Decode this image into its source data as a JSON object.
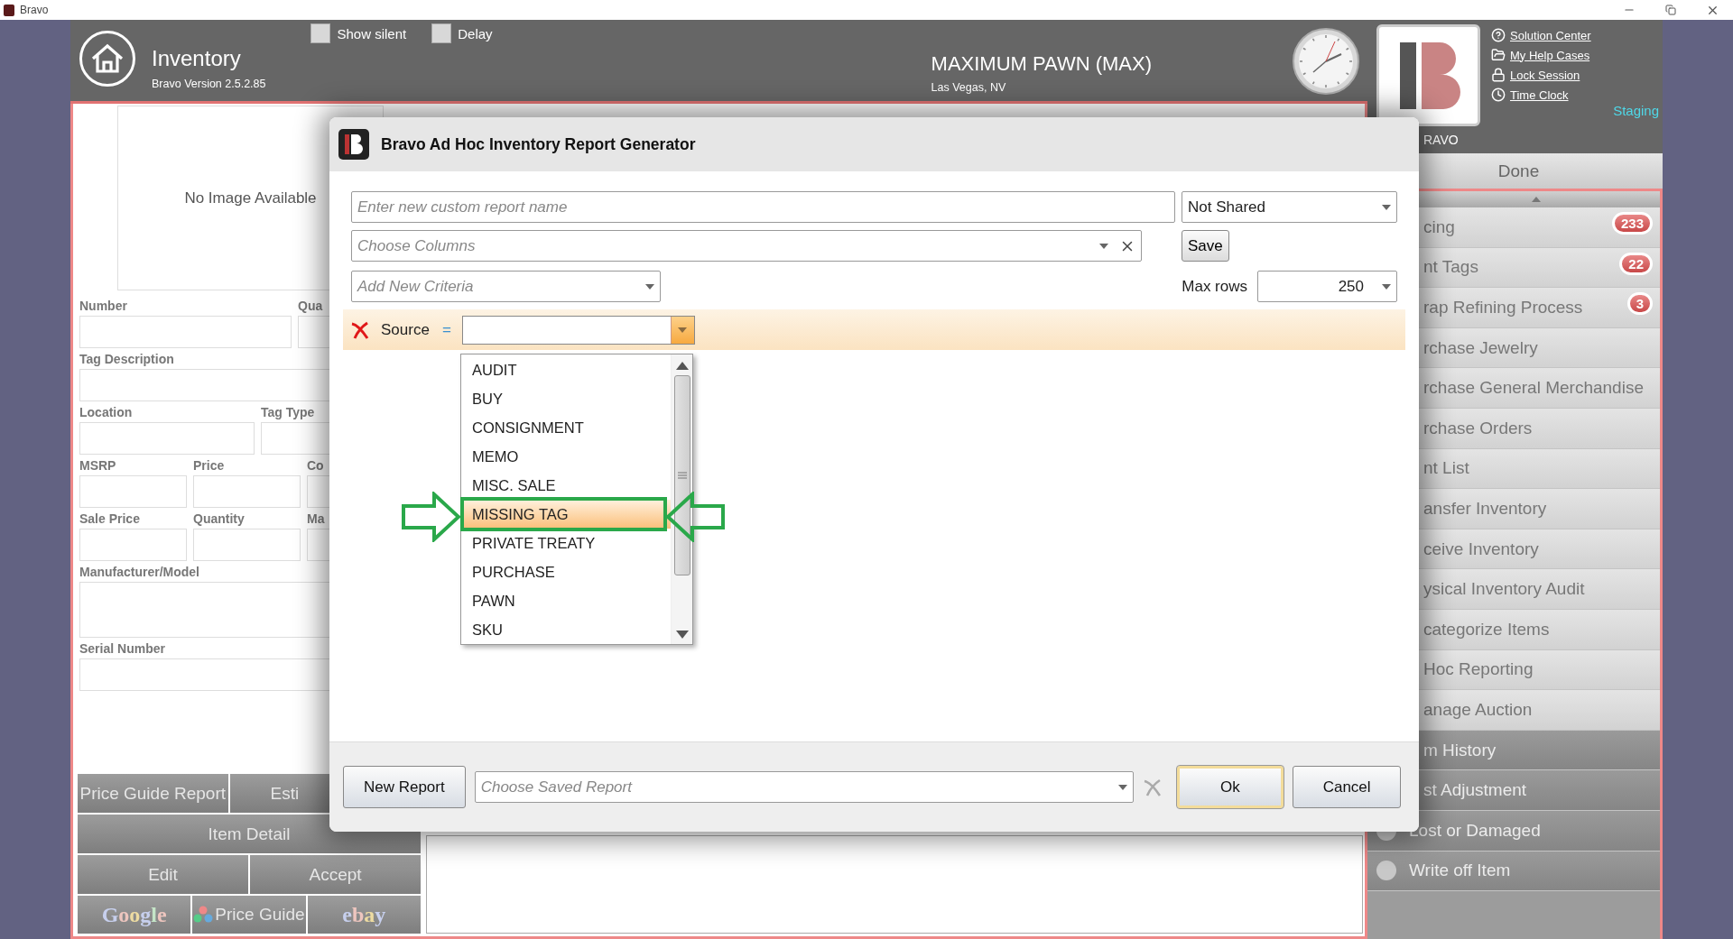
{
  "window": {
    "title": "Bravo"
  },
  "header": {
    "title": "Inventory",
    "version": "Bravo Version 2.5.2.85",
    "options": [
      {
        "label": "Show silent",
        "checked": false
      },
      {
        "label": "Delay",
        "checked": false
      }
    ],
    "store_name": "MAXIMUM PAWN (MAX)",
    "store_location": "Las Vegas, NV"
  },
  "account": {
    "links": [
      {
        "label": "Solution Center",
        "kind": "help"
      },
      {
        "label": "My Help Cases",
        "kind": "cases"
      },
      {
        "label": "Lock Session",
        "kind": "lock"
      },
      {
        "label": "Time Clock",
        "kind": "clock"
      }
    ],
    "environment": "Staging",
    "logo_caption": "RAVO"
  },
  "sidebar": {
    "done_label": "Done",
    "items": [
      {
        "label": "cing",
        "badge": "233",
        "kind": "task",
        "disabled": false
      },
      {
        "label": "nt Tags",
        "badge": "22",
        "kind": "task",
        "disabled": false
      },
      {
        "label": "rap Refining Process",
        "badge": "3",
        "kind": "task",
        "disabled": false
      },
      {
        "label": "rchase Jewelry",
        "kind": "task",
        "disabled": false
      },
      {
        "label": "rchase General Merchandise",
        "kind": "task",
        "disabled": false
      },
      {
        "label": "rchase Orders",
        "kind": "task",
        "disabled": false
      },
      {
        "label": "nt List",
        "kind": "task",
        "disabled": false
      },
      {
        "label": "ansfer Inventory",
        "kind": "task",
        "disabled": false
      },
      {
        "label": "ceive Inventory",
        "kind": "task",
        "disabled": false
      },
      {
        "label": "ysical Inventory Audit",
        "kind": "task",
        "disabled": false
      },
      {
        "label": "categorize Items",
        "kind": "task",
        "disabled": false
      },
      {
        "label": "Hoc Reporting",
        "kind": "task",
        "disabled": false
      },
      {
        "label": "anage Auction",
        "kind": "task",
        "disabled": false
      },
      {
        "label": "m History",
        "kind": "task",
        "disabled": true
      },
      {
        "label": "st Adjustment",
        "kind": "task",
        "disabled": true
      },
      {
        "label": "Lost or Damaged",
        "kind": "option",
        "disabled": true
      },
      {
        "label": "Write off Item",
        "kind": "option",
        "disabled": true
      }
    ]
  },
  "item_form": {
    "image_placeholder": "No Image Available",
    "rows": [
      {
        "fields": [
          {
            "label": "Number"
          },
          {
            "label": "Qua"
          }
        ]
      },
      {
        "fields": [
          {
            "label": "Tag Description"
          }
        ]
      },
      {
        "fields": [
          {
            "label": "Location"
          },
          {
            "label": "Tag Type"
          }
        ]
      },
      {
        "fields": [
          {
            "label": "MSRP"
          },
          {
            "label": "Price"
          },
          {
            "label": "Co"
          }
        ]
      },
      {
        "fields": [
          {
            "label": "Sale Price"
          },
          {
            "label": "Quantity"
          },
          {
            "label": "Ma"
          }
        ]
      },
      {
        "fields": [
          {
            "label": "Manufacturer/Model",
            "kind": "multiline"
          }
        ]
      },
      {
        "fields": [
          {
            "label": "Serial Number"
          }
        ]
      }
    ]
  },
  "actions": [
    [
      {
        "label": "Price Guide Report",
        "kind": "text",
        "disabled": true
      },
      {
        "label": "Esti",
        "kind": "text",
        "disabled": true
      }
    ],
    [
      {
        "label": "Item Detail",
        "kind": "text",
        "disabled": true
      }
    ],
    [
      {
        "label": "Edit",
        "kind": "text",
        "disabled": true
      },
      {
        "label": "Accept",
        "kind": "text",
        "disabled": true
      }
    ],
    [
      {
        "label": "Google",
        "kind": "wordmark",
        "disabled": true
      },
      {
        "label": "Price Guide",
        "kind": "dots",
        "disabled": true
      },
      {
        "label": "ebay",
        "kind": "wordmark",
        "disabled": true
      }
    ]
  ],
  "dialog": {
    "title": "Bravo Ad Hoc Inventory Report Generator",
    "report_name": {
      "placeholder": "Enter new custom report name"
    },
    "sharing": {
      "value": "Not Shared"
    },
    "columns": {
      "placeholder": "Choose Columns"
    },
    "save_label": "Save",
    "criteria_picker": {
      "placeholder": "Add New Criteria"
    },
    "max_rows": {
      "label": "Max rows",
      "value": "250"
    },
    "criteria": [
      {
        "field": "Source",
        "operator": "=",
        "expanded": true,
        "options": [
          {
            "label": "AUDIT",
            "selected": false
          },
          {
            "label": "BUY",
            "selected": false
          },
          {
            "label": "CONSIGNMENT",
            "selected": false
          },
          {
            "label": "MEMO",
            "selected": false
          },
          {
            "label": "MISC. SALE",
            "selected": false
          },
          {
            "label": "MISSING TAG",
            "selected": true
          },
          {
            "label": "PRIVATE TREATY",
            "selected": false
          },
          {
            "label": "PURCHASE",
            "selected": false
          },
          {
            "label": "PAWN",
            "selected": false
          },
          {
            "label": "SKU",
            "selected": false
          }
        ]
      }
    ],
    "footer": {
      "new_report": "New Report",
      "saved_report": {
        "placeholder": "Choose Saved Report"
      },
      "ok": {
        "label": "Ok",
        "focused": true
      },
      "cancel": "Cancel"
    }
  }
}
